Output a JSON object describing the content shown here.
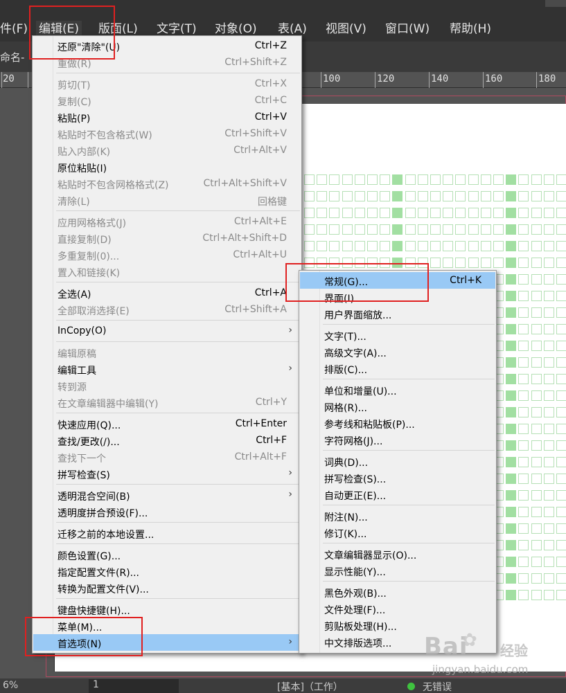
{
  "menubar": {
    "items": [
      "件(F)",
      "编辑(E)",
      "版面(L)",
      "文字(T)",
      "对象(O)",
      "表(A)",
      "视图(V)",
      "窗口(W)",
      "帮助(H)"
    ]
  },
  "doc_tab": "命名-",
  "ruler": {
    "ticks": [
      "20",
      "100",
      "120",
      "140",
      "160",
      "180"
    ]
  },
  "edit_menu": {
    "items": [
      {
        "label": "还原\"清除\"(U)",
        "shortcut": "Ctrl+Z",
        "disabled": false
      },
      {
        "label": "重做(R)",
        "shortcut": "Ctrl+Shift+Z",
        "disabled": true
      },
      {
        "label": "剪切(T)",
        "shortcut": "Ctrl+X",
        "disabled": true
      },
      {
        "label": "复制(C)",
        "shortcut": "Ctrl+C",
        "disabled": true
      },
      {
        "label": "粘贴(P)",
        "shortcut": "Ctrl+V",
        "disabled": false
      },
      {
        "label": "粘贴时不包含格式(W)",
        "shortcut": "Ctrl+Shift+V",
        "disabled": true
      },
      {
        "label": "贴入内部(K)",
        "shortcut": "Ctrl+Alt+V",
        "disabled": true
      },
      {
        "label": "原位粘贴(I)",
        "shortcut": "",
        "disabled": false
      },
      {
        "label": "粘贴时不包含网格格式(Z)",
        "shortcut": "Ctrl+Alt+Shift+V",
        "disabled": true
      },
      {
        "label": "清除(L)",
        "shortcut": "回格键",
        "disabled": true
      },
      {
        "label": "应用网格格式(J)",
        "shortcut": "Ctrl+Alt+E",
        "disabled": true
      },
      {
        "label": "直接复制(D)",
        "shortcut": "Ctrl+Alt+Shift+D",
        "disabled": true
      },
      {
        "label": "多重复制(0)...",
        "shortcut": "Ctrl+Alt+U",
        "disabled": true
      },
      {
        "label": "置入和链接(K)",
        "shortcut": "",
        "disabled": true
      },
      {
        "label": "全选(A)",
        "shortcut": "Ctrl+A",
        "disabled": false
      },
      {
        "label": "全部取消选择(E)",
        "shortcut": "Ctrl+Shift+A",
        "disabled": true
      },
      {
        "label": "InCopy(O)",
        "shortcut": "",
        "disabled": false,
        "submenu": true
      },
      {
        "label": "编辑原稿",
        "shortcut": "",
        "disabled": true
      },
      {
        "label": "编辑工具",
        "shortcut": "",
        "disabled": false,
        "submenu": true
      },
      {
        "label": "转到源",
        "shortcut": "",
        "disabled": true
      },
      {
        "label": "在文章编辑器中编辑(Y)",
        "shortcut": "Ctrl+Y",
        "disabled": true
      },
      {
        "label": "快速应用(Q)...",
        "shortcut": "Ctrl+Enter",
        "disabled": false
      },
      {
        "label": "查找/更改(/)...",
        "shortcut": "Ctrl+F",
        "disabled": false
      },
      {
        "label": "查找下一个",
        "shortcut": "Ctrl+Alt+F",
        "disabled": true
      },
      {
        "label": "拼写检查(S)",
        "shortcut": "",
        "disabled": false,
        "submenu": true
      },
      {
        "label": "透明混合空间(B)",
        "shortcut": "",
        "disabled": false,
        "submenu": true
      },
      {
        "label": "透明度拼合预设(F)...",
        "shortcut": "",
        "disabled": false
      },
      {
        "label": "迁移之前的本地设置...",
        "shortcut": "",
        "disabled": false
      },
      {
        "label": "颜色设置(G)...",
        "shortcut": "",
        "disabled": false
      },
      {
        "label": "指定配置文件(R)...",
        "shortcut": "",
        "disabled": false
      },
      {
        "label": "转换为配置文件(V)...",
        "shortcut": "",
        "disabled": false
      },
      {
        "label": "键盘快捷键(H)...",
        "shortcut": "",
        "disabled": false
      },
      {
        "label": "菜单(M)...",
        "shortcut": "",
        "disabled": false
      },
      {
        "label": "首选项(N)",
        "shortcut": "",
        "disabled": false,
        "submenu": true,
        "highlighted": true
      }
    ]
  },
  "prefs_menu": {
    "items": [
      {
        "label": "常规(G)...",
        "shortcut": "Ctrl+K",
        "highlighted": true
      },
      {
        "label": "界面(I)...",
        "shortcut": ""
      },
      {
        "label": "用户界面缩放...",
        "shortcut": ""
      },
      {
        "label": "文字(T)...",
        "shortcut": ""
      },
      {
        "label": "高级文字(A)...",
        "shortcut": ""
      },
      {
        "label": "排版(C)...",
        "shortcut": ""
      },
      {
        "label": "单位和增量(U)...",
        "shortcut": ""
      },
      {
        "label": "网格(R)...",
        "shortcut": ""
      },
      {
        "label": "参考线和粘贴板(P)...",
        "shortcut": ""
      },
      {
        "label": "字符网格(J)...",
        "shortcut": ""
      },
      {
        "label": "词典(D)...",
        "shortcut": ""
      },
      {
        "label": "拼写检查(S)...",
        "shortcut": ""
      },
      {
        "label": "自动更正(E)...",
        "shortcut": ""
      },
      {
        "label": "附注(N)...",
        "shortcut": ""
      },
      {
        "label": "修订(K)...",
        "shortcut": ""
      },
      {
        "label": "文章编辑器显示(O)...",
        "shortcut": ""
      },
      {
        "label": "显示性能(Y)...",
        "shortcut": ""
      },
      {
        "label": "黑色外观(B)...",
        "shortcut": ""
      },
      {
        "label": "文件处理(F)...",
        "shortcut": ""
      },
      {
        "label": "剪贴板处理(H)...",
        "shortcut": ""
      },
      {
        "label": "中文排版选项...",
        "shortcut": ""
      }
    ]
  },
  "statusbar": {
    "zoom": "6%",
    "page": "1",
    "style": "[基本]（工作）",
    "preflight": "无错误"
  },
  "watermark": {
    "brand": "Bai",
    "brand_cn": "经验",
    "url": "jingyan.baidu.com"
  }
}
